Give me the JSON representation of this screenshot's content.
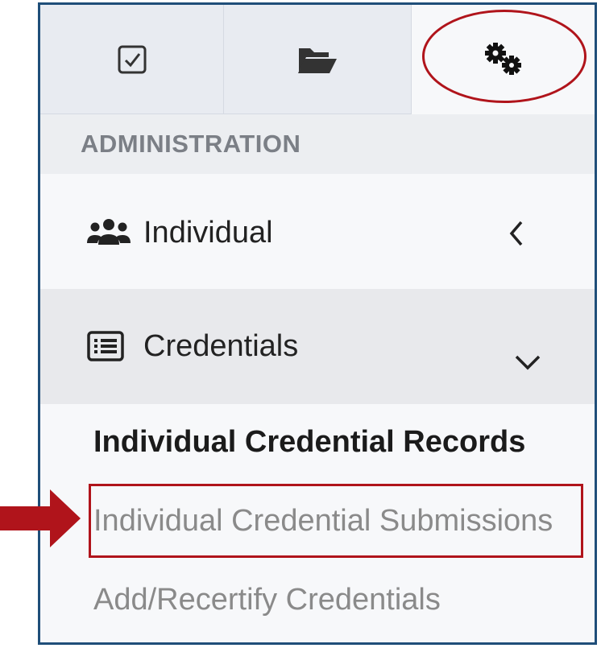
{
  "tabs": [
    {
      "icon": "checkbox-icon"
    },
    {
      "icon": "folder-open-icon"
    },
    {
      "icon": "gears-icon"
    }
  ],
  "section": {
    "title": "ADMINISTRATION"
  },
  "nav": [
    {
      "label": "Individual",
      "icon": "users-icon",
      "chevron": "chevron-left-icon"
    },
    {
      "label": "Credentials",
      "icon": "list-icon",
      "chevron": "chevron-down-icon"
    }
  ],
  "submenu": [
    {
      "label": "Individual Credential Records"
    },
    {
      "label": "Individual Credential Submissions"
    },
    {
      "label": "Add/Recertify Credentials"
    }
  ],
  "colors": {
    "panel_border": "#1f4e79",
    "annotation": "#b0141b",
    "active_text": "#1b1b1b",
    "muted_text": "#8a8a8a"
  }
}
